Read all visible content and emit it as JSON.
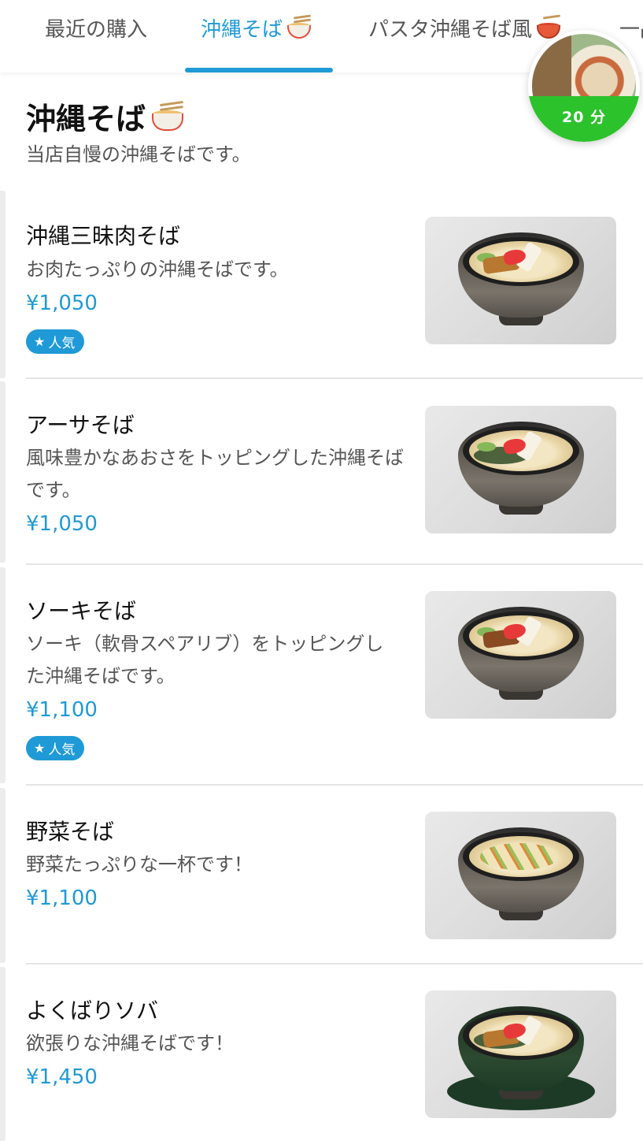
{
  "tabs": [
    {
      "label": "最近の購入",
      "active": false
    },
    {
      "label": "沖縄そば",
      "active": true,
      "icon": "ramen-bowl-icon"
    },
    {
      "label": "パスタ沖縄そば風",
      "active": false,
      "icon": "spaghetti-icon"
    },
    {
      "label": "一品",
      "active": false
    }
  ],
  "timer_badge": {
    "label": "20 分"
  },
  "category": {
    "title": "沖縄そば",
    "description": "当店自慢の沖縄そばです。"
  },
  "items": [
    {
      "name": "沖縄三昧肉そば",
      "description": "お肉たっぷりの沖縄そばです。",
      "price": "¥1,050",
      "badge": "人気"
    },
    {
      "name": "アーサそば",
      "description": "風味豊かなあおさをトッピングした沖縄そばです。",
      "price": "¥1,050"
    },
    {
      "name": "ソーキそば",
      "description": "ソーキ（軟骨スペアリブ）をトッピングした沖縄そばです。",
      "price": "¥1,100",
      "badge": "人気"
    },
    {
      "name": "野菜そば",
      "description": "野菜たっぷりな一杯です！",
      "price": "¥1,100"
    },
    {
      "name": "よくばりソバ",
      "description": "欲張りな沖縄そばです！",
      "price": "¥1,450"
    }
  ],
  "colors": {
    "accent": "#1f9ad6",
    "timer_green": "#2cc22c",
    "text": "#111111",
    "muted": "#555555"
  }
}
